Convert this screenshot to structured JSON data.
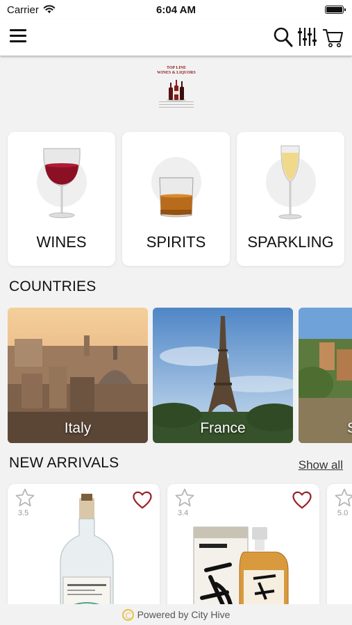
{
  "status_bar": {
    "carrier": "Carrier",
    "time": "6:04 AM"
  },
  "header": {
    "icons": [
      "menu-icon",
      "search-icon",
      "filter-icon",
      "cart-icon"
    ]
  },
  "logo": {
    "line1": "TOP LINE",
    "line2": "WINES & LIQUORS"
  },
  "categories": [
    {
      "label": "WINES",
      "icon": "red-wine-glass-icon"
    },
    {
      "label": "SPIRITS",
      "icon": "whiskey-glass-icon"
    },
    {
      "label": "SPARKLING",
      "icon": "champagne-flute-icon"
    }
  ],
  "countries_section": {
    "title": "COUNTRIES"
  },
  "countries": [
    {
      "label": "Italy"
    },
    {
      "label": "France"
    },
    {
      "label": "S"
    }
  ],
  "new_arrivals": {
    "title": "NEW ARRIVALS",
    "show_all": "Show all",
    "products": [
      {
        "rating": "3.5",
        "favorite": true
      },
      {
        "rating": "3.4",
        "favorite": true
      },
      {
        "rating": "5.0",
        "favorite": false
      }
    ]
  },
  "footer": {
    "text": "Powered by City Hive"
  },
  "colors": {
    "wine_red": "#8b1c1c",
    "heart_red": "#9b2226",
    "footer_accent": "#e4c04a"
  }
}
